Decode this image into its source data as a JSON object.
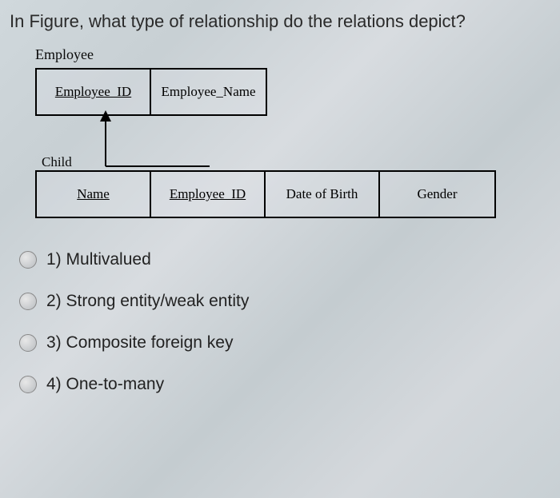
{
  "question": "In Figure, what type of relationship do the relations depict?",
  "diagram": {
    "entity1": {
      "label": "Employee",
      "attributes": [
        {
          "text": "Employee_ID",
          "underline": true
        },
        {
          "text": "Employee_Name",
          "underline": false
        }
      ]
    },
    "entity2": {
      "label": "Child",
      "attributes": [
        {
          "text": "Name",
          "underline": true
        },
        {
          "text": "Employee_ID",
          "underline": true
        },
        {
          "text": "Date of Birth",
          "underline": false
        },
        {
          "text": "Gender",
          "underline": false
        }
      ]
    }
  },
  "options": [
    {
      "number": "1)",
      "text": "Multivalued"
    },
    {
      "number": "2)",
      "text": "Strong entity/weak entity"
    },
    {
      "number": "3)",
      "text": "Composite foreign key"
    },
    {
      "number": "4)",
      "text": "One-to-many"
    }
  ]
}
